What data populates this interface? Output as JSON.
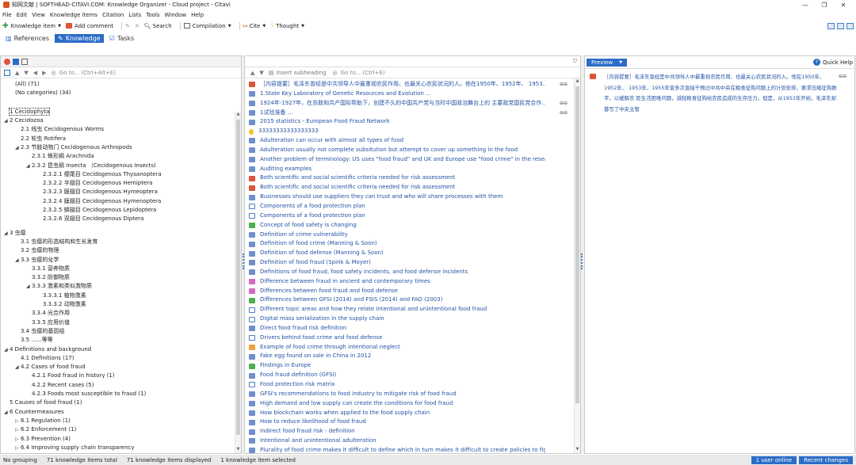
{
  "window": {
    "title": "知网文献 | SOFTHEAD-CITAVI.COM: Knowledge Organizer - Cloud project - Citavi",
    "controls": [
      "—",
      "❐",
      "✕"
    ]
  },
  "menu": [
    "File",
    "Edit",
    "View",
    "Knowledge items",
    "Citation",
    "Lists",
    "Tools",
    "Window",
    "Help"
  ],
  "toolbar": {
    "knowledge_item": "Knowledge item",
    "add_comment": "Add comment",
    "search": "Search",
    "compilation": "Compilation",
    "cite": "Cite",
    "thought": "Thought"
  },
  "view_tabs": [
    "References",
    "Knowledge",
    "Tasks"
  ],
  "left_pane": {
    "goto_placeholder": "Go to... (Ctrl+Alt+E)",
    "all": "(All) (71)",
    "no_categories": "(No categories) (34)",
    "tree": [
      {
        "level": 0,
        "arrow": "",
        "label": "1 Cecidophyta",
        "selected": true
      },
      {
        "level": 0,
        "arrow": "◢",
        "label": "2 Cecidozoa"
      },
      {
        "level": 1,
        "arrow": "",
        "label": "2.1 线虫 Cecidogenous Worms"
      },
      {
        "level": 1,
        "arrow": "",
        "label": "2.2 轮虫 Rotifera"
      },
      {
        "level": 1,
        "arrow": "◢",
        "label": "2.3 节肢动物门 Cecidogenous Arthropods"
      },
      {
        "level": 2,
        "arrow": "",
        "label": "2.3.1 蛛形纲 Arachnida"
      },
      {
        "level": 2,
        "arrow": "◢",
        "label": "2.3.2 昆虫纲 Insecta （Cecidogenous Insects)"
      },
      {
        "level": 3,
        "arrow": "",
        "label": "2.3.2.1 缨尾目 Cecidogenous Thysanoptera"
      },
      {
        "level": 3,
        "arrow": "",
        "label": "2.3.2.2 半翅目 Cecidogenous Hemiptera"
      },
      {
        "level": 3,
        "arrow": "",
        "label": "2.3.2.3 膜翅目 Cecidogenous Hymeoptera"
      },
      {
        "level": 3,
        "arrow": "",
        "label": "2.3.2.4 膜翅目 Cecidogenous Hymenoptera"
      },
      {
        "level": 3,
        "arrow": "",
        "label": "2.3.2.5 鳞翅目 Cecidogenous Lepidoptera"
      },
      {
        "level": 3,
        "arrow": "",
        "label": "2.3.2.6 双翅目 Cecidogenous Diptera"
      },
      {
        "level": 0,
        "arrow": "",
        "label": ""
      },
      {
        "level": 0,
        "arrow": "◢",
        "label": "3 虫瘿"
      },
      {
        "level": 1,
        "arrow": "",
        "label": "3.1 虫瘿的形态结构和生长发育"
      },
      {
        "level": 1,
        "arrow": "",
        "label": "3.2 虫瘿的物理"
      },
      {
        "level": 1,
        "arrow": "◢",
        "label": "3.3 虫瘿的化学"
      },
      {
        "level": 2,
        "arrow": "",
        "label": "3.3.1 营养物质"
      },
      {
        "level": 2,
        "arrow": "",
        "label": "3.3.2 防御物质"
      },
      {
        "level": 2,
        "arrow": "◢",
        "label": "3.3.3 激素和类似激物质"
      },
      {
        "level": 3,
        "arrow": "",
        "label": "3.3.3.1 植物激素"
      },
      {
        "level": 3,
        "arrow": "",
        "label": "3.3.3.2 动物激素"
      },
      {
        "level": 2,
        "arrow": "",
        "label": "3.3.4 光合作用"
      },
      {
        "level": 2,
        "arrow": "",
        "label": "3.3.5 应用价值"
      },
      {
        "level": 1,
        "arrow": "",
        "label": "3.4 虫瘿的基因组"
      },
      {
        "level": 1,
        "arrow": "",
        "label": "3.5 ......等等"
      },
      {
        "level": 0,
        "arrow": "◢",
        "label": "4 Definitions and background"
      },
      {
        "level": 1,
        "arrow": "",
        "label": "4.1 Definitions (17)"
      },
      {
        "level": 1,
        "arrow": "◢",
        "label": "4.2 Cases of food fraud"
      },
      {
        "level": 2,
        "arrow": "",
        "label": "4.2.1 Food fraud in history (1)"
      },
      {
        "level": 2,
        "arrow": "",
        "label": "4.2.2 Recent cases (5)"
      },
      {
        "level": 2,
        "arrow": "",
        "label": "4.2.3 Foods most susceptible to fraud (1)"
      },
      {
        "level": 0,
        "arrow": "",
        "label": "5 Causes of food fraud (1)"
      },
      {
        "level": 0,
        "arrow": "◢",
        "label": "6 Countermeasures"
      },
      {
        "level": 1,
        "arrow": "▷",
        "label": "6.1 Regulation (1)"
      },
      {
        "level": 1,
        "arrow": "▷",
        "label": "6.2 Enforcement (1)"
      },
      {
        "level": 1,
        "arrow": "▷",
        "label": "6.3 Prevention (4)"
      },
      {
        "level": 1,
        "arrow": "▷",
        "label": "6.4 Improving supply chain transparency"
      }
    ]
  },
  "middle_pane": {
    "insert_subheading": "Insert subheading",
    "goto_placeholder": "Go to... (Ctrl+E)",
    "items": [
      {
        "icon": "quote-red",
        "text": "［内容提要］毛泽东曾经是中共领导人中最重视农民作用、也最关心农民状况的人。他在1950年、1952年、 1953...",
        "link": "⊖⊖",
        "highlight": true
      },
      {
        "icon": "quote-blue",
        "text": "1.State Key Laboratory of Genetic Resources and Evolution ..."
      },
      {
        "icon": "quote-blue",
        "text": "1924年-1927年，在苏联和共产国际帮助下，创建不久的中国共产党与当时中国政治舞台上的 主要政党国民党合作...",
        "link": "⊖⊖"
      },
      {
        "icon": "quote-blue",
        "text": "1试验准备 ...",
        "link": "⊖⊖"
      },
      {
        "icon": "quote-blue",
        "text": "2015 statistics - European Food Fraud Network"
      },
      {
        "icon": "idea-yellow",
        "text": "33333333333333333"
      },
      {
        "icon": "quote-blue",
        "text": "Adulteration can occur with almost all types of food"
      },
      {
        "icon": "quote-blue",
        "text": "Adulteration usually not complete subsitution but attempt to cover up something in the food"
      },
      {
        "icon": "quote-blue",
        "text": "Another problem of terminology: US uses \"food fraud\" and UK and Europe use \"food crime\" in the resear..."
      },
      {
        "icon": "quote-blue",
        "text": "Auditing examples"
      },
      {
        "icon": "quote-red",
        "text": "Both scientific and social scientific criteria needed for risk assessment"
      },
      {
        "icon": "quote-red",
        "text": "Both scientific and social scientific criteria needed for risk assessment"
      },
      {
        "icon": "quote-blue",
        "text": "Businesses should use suppliers they can trust and who will share processes with them"
      },
      {
        "icon": "image-blue",
        "text": "Components of a food protection plan"
      },
      {
        "icon": "image-blue",
        "text": "Components of a food protection plan"
      },
      {
        "icon": "quote-green",
        "text": "Concept of food safety is changing"
      },
      {
        "icon": "quote-blue",
        "text": "Definition of crime vulnerability"
      },
      {
        "icon": "quote-blue",
        "text": "Definition of food crime (Manning & Soon)"
      },
      {
        "icon": "quote-blue",
        "text": "Definition of food defense (Manning & Soon)"
      },
      {
        "icon": "quote-blue",
        "text": "Definition of food fraud (Spink & Moyer)"
      },
      {
        "icon": "quote-blue",
        "text": "Definitions of food fraud, food safety incidents, and food defense incidents"
      },
      {
        "icon": "quote-pink",
        "text": "Difference between fraud in ancient and contemporary times"
      },
      {
        "icon": "quote-pink",
        "text": "Differences between food fraud and food defense"
      },
      {
        "icon": "quote-green",
        "text": "Differences between GFSI (2014) and FSIS (2014) and FAO (2003)"
      },
      {
        "icon": "image-blue",
        "text": "Different topic areas and how they relate intentional and unintentional food fraud"
      },
      {
        "icon": "image-blue",
        "text": "Digital mass serialization in the supply chain"
      },
      {
        "icon": "quote-blue",
        "text": "Direct food fraud risk definition"
      },
      {
        "icon": "image-blue",
        "text": "Drivers behind food crime and food defense"
      },
      {
        "icon": "quote-orange",
        "text": "Example of food crime through intentional neglect"
      },
      {
        "icon": "quote-blue",
        "text": "Fake egg found on sale in China in 2012"
      },
      {
        "icon": "quote-green",
        "text": "Findings in Europe"
      },
      {
        "icon": "quote-blue",
        "text": "Food fraud definition (GFSI)"
      },
      {
        "icon": "image-blue",
        "text": "Food protection risk matrix"
      },
      {
        "icon": "quote-blue",
        "text": "GFSI's recommendations to food industry to mitigate risk of food fraud"
      },
      {
        "icon": "quote-blue",
        "text": "High demand and low supply can create the conditions for food fraud"
      },
      {
        "icon": "quote-blue",
        "text": "How blockchain works when applied to the food supply chain"
      },
      {
        "icon": "quote-blue",
        "text": "How to reduce likelihood of food fraud"
      },
      {
        "icon": "quote-blue",
        "text": "Indirect food fraud risk - definition"
      },
      {
        "icon": "quote-blue",
        "text": "Intentional and unintentional adulteration"
      },
      {
        "icon": "quote-blue",
        "text": "Plurality of food crime makes it difficult to define which in turn makes it difficult to create policies to fight..."
      }
    ]
  },
  "right_pane": {
    "preview_label": "Preview",
    "quick_help": "Quick Help",
    "preview_text": "［内容提要］毛泽东曾经是中共领导人中最重视农民作用、也最关心农民状况的人。他在1950年、1952年、 1953年、1955年曾多次直接干预过中共中央在粮食征购问题上的计划安排，要求压缩征购数字，以缓解农 民生活困难问题，减轻粮食征购给农民造成的生存压力。但是，从1953年开始，毛泽东却篡写了中央主管",
    "link_icon": "⊖⊖"
  },
  "statusbar": {
    "grouping": "No grouping",
    "total": "71 knowledge items total",
    "displayed": "71 knowledge items displayed",
    "selected": "1 knowledge item selected",
    "user_online": "1 user online",
    "recent_changes": "Recent changes"
  },
  "colors": {
    "accent": "#2b6cc7",
    "link_text": "#2452a5",
    "quote-blue": "#6f8fce",
    "quote-red": "#e0533d",
    "quote-green": "#4caf50",
    "quote-pink": "#d36bc0",
    "quote-orange": "#f0a23b",
    "idea-yellow": "#f2c624",
    "image-blue": "#4a7fc1"
  }
}
